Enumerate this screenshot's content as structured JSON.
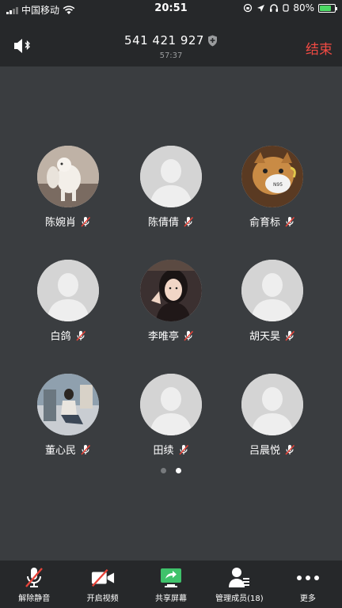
{
  "status_bar": {
    "carrier": "中国移动",
    "time": "20:51",
    "battery": "80%",
    "battery_level": 0.8
  },
  "header": {
    "meeting_id": "541 421 927",
    "timer": "57:37",
    "end_label": "结束"
  },
  "participants": [
    {
      "name": "陈婉肖",
      "avatar": "photo-llama-toy",
      "muted": true
    },
    {
      "name": "陈倩倩",
      "avatar": "default-silhouette",
      "muted": true
    },
    {
      "name": "俞育标",
      "avatar": "photo-dog-mask",
      "muted": true
    },
    {
      "name": "白鸽",
      "avatar": "default-silhouette",
      "muted": true
    },
    {
      "name": "李唯亭",
      "avatar": "photo-girl",
      "muted": true
    },
    {
      "name": "胡天昊",
      "avatar": "default-silhouette",
      "muted": true
    },
    {
      "name": "董心民",
      "avatar": "photo-sitting-person",
      "muted": true
    },
    {
      "name": "田续",
      "avatar": "default-silhouette",
      "muted": true
    },
    {
      "name": "吕晨悦",
      "avatar": "default-silhouette",
      "muted": true
    }
  ],
  "pagination": {
    "pages": 2,
    "current": 2
  },
  "toolbar": {
    "unmute": "解除静音",
    "video": "开启视频",
    "share": "共享屏幕",
    "manage": "管理成员(18)",
    "more": "更多"
  },
  "colors": {
    "background": "#3a3d40",
    "bar": "#26282a",
    "end_red": "#f04a43",
    "mute_red": "#e8443a",
    "share_green": "#3fc26b"
  }
}
